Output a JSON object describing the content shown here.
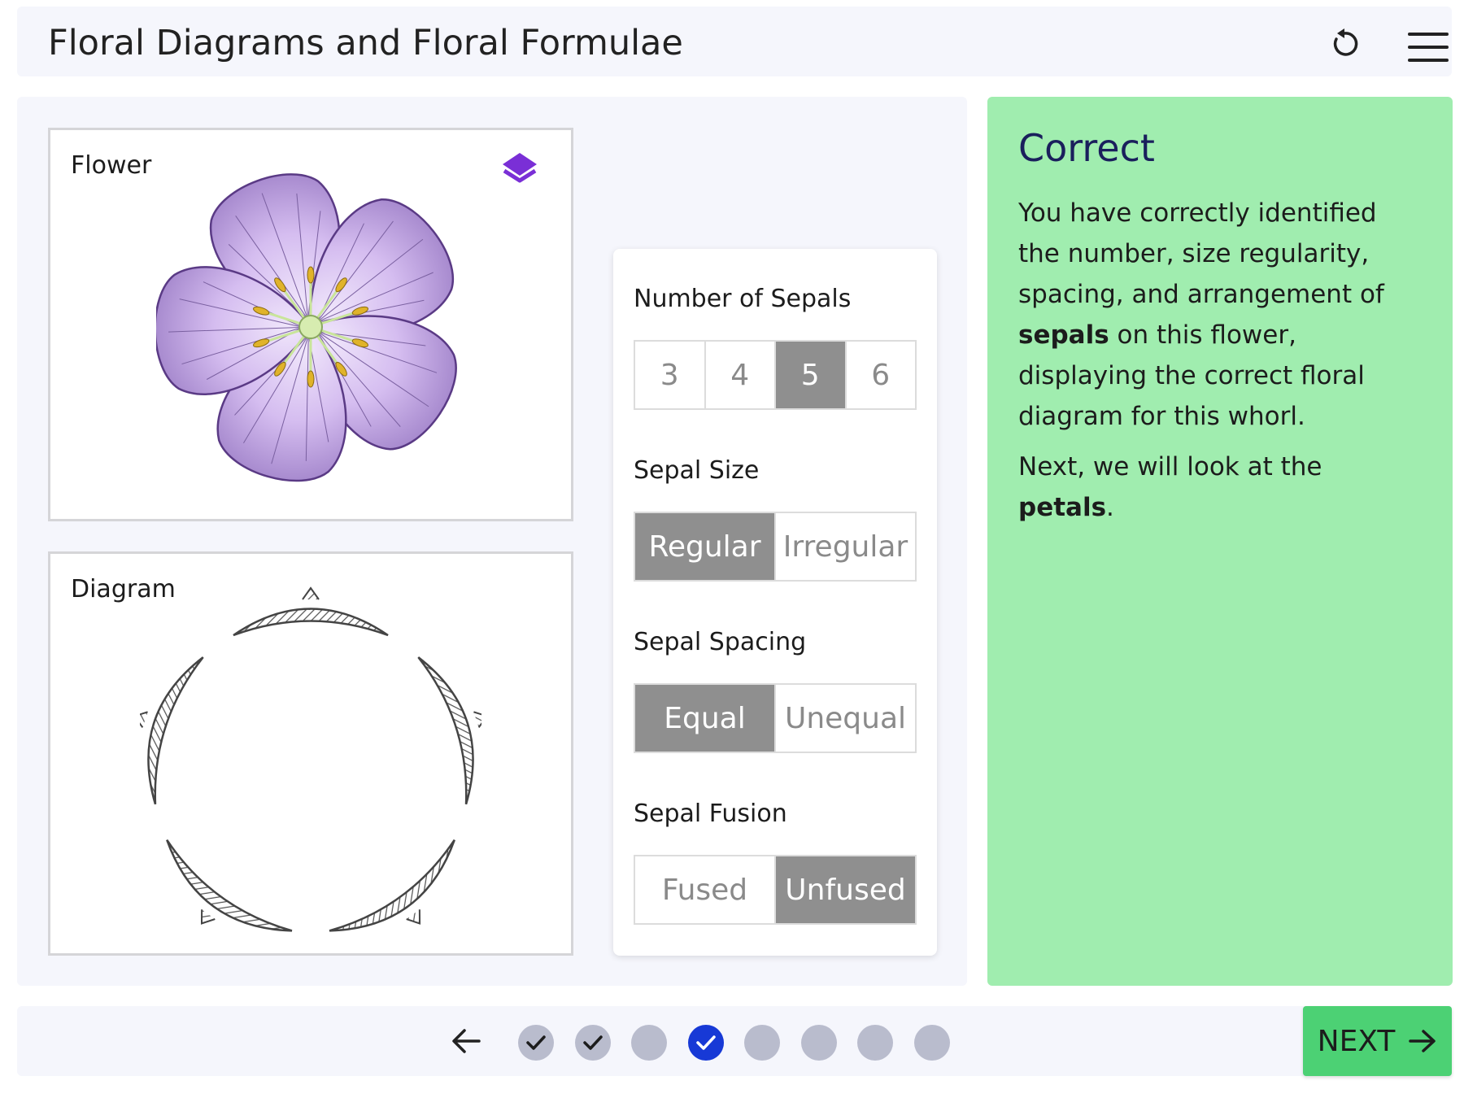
{
  "header": {
    "title": "Floral Diagrams and Floral Formulae",
    "reset_icon": "reset-icon",
    "menu_icon": "hamburger-menu-icon"
  },
  "flower_panel": {
    "label": "Flower",
    "layers_icon": "layers-icon",
    "layers_color": "#7a2fd6"
  },
  "diagram_panel": {
    "label": "Diagram"
  },
  "controls": {
    "num_sepals": {
      "label": "Number of Sepals",
      "options": [
        "3",
        "4",
        "5",
        "6"
      ],
      "selected": "5"
    },
    "sepal_size": {
      "label": "Sepal Size",
      "options": [
        "Regular",
        "Irregular"
      ],
      "selected": "Regular"
    },
    "sepal_spacing": {
      "label": "Sepal Spacing",
      "options": [
        "Equal",
        "Unequal"
      ],
      "selected": "Equal"
    },
    "sepal_fusion": {
      "label": "Sepal Fusion",
      "options": [
        "Fused",
        "Unfused"
      ],
      "selected": "Unfused"
    }
  },
  "feedback": {
    "title": "Correct",
    "p1_a": "You have correctly identified the number, size regularity, spacing, and arrangement of ",
    "p1_bold": "sepals",
    "p1_b": " on this flower, displaying the correct floral diagram for this whorl.",
    "p2_a": "Next, we will look at the ",
    "p2_bold": "petals",
    "p2_b": ".",
    "background": "#a0edaf"
  },
  "footer": {
    "back_icon": "arrow-left-icon",
    "steps": [
      "completed",
      "completed",
      "pending",
      "current-completed",
      "pending",
      "pending",
      "pending",
      "pending"
    ],
    "next_label": "NEXT",
    "next_icon": "arrow-right-icon",
    "accent": "#1739d6",
    "next_color": "#4cd174"
  }
}
